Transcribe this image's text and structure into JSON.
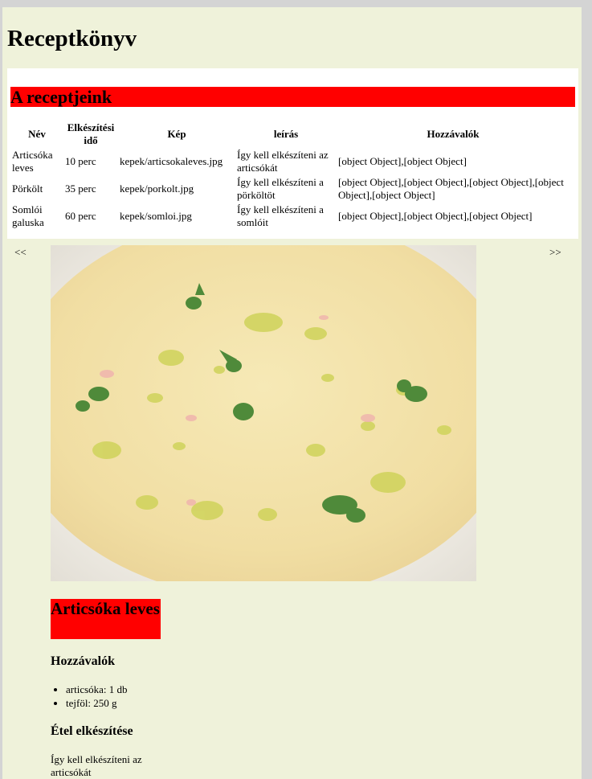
{
  "site": {
    "title": "Receptkönyv"
  },
  "list": {
    "heading": "A receptjeink",
    "columns": {
      "name": "Név",
      "time": "Elkészítési idő",
      "image": "Kép",
      "description": "leírás",
      "ingredients": "Hozzávalók"
    },
    "rows": [
      {
        "name": "Articsóka leves",
        "time": "10 perc",
        "image": "kepek/articsokaleves.jpg",
        "description": "Így kell elkészíteni az articsókát",
        "ingredients": "[object Object],[object Object]"
      },
      {
        "name": "Pörkölt",
        "time": "35 perc",
        "image": "kepek/porkolt.jpg",
        "description": "Így kell elkészíteni a pörköltöt",
        "ingredients": "[object Object],[object Object],[object Object],[object Object],[object Object]"
      },
      {
        "name": "Somlói galuska",
        "time": "60 perc",
        "image": "kepek/somloi.jpg",
        "description": "Így kell elkészíteni a somlóit",
        "ingredients": "[object Object],[object Object],[object Object]"
      }
    ]
  },
  "slider": {
    "prev_label": "<<",
    "next_label": ">>"
  },
  "detail": {
    "title": "Articsóka leves",
    "ingredients_heading": "Hozzávalók",
    "ingredients": [
      "articsóka: 1 db",
      "tejföl: 250 g"
    ],
    "prep_heading": "Étel elkészítése",
    "prep_text": "Így kell elkészíteni az articsókát"
  },
  "colors": {
    "page_bg": "#eff2da",
    "accent_red": "#ff0000",
    "outer_bg": "#d4d4d4"
  }
}
